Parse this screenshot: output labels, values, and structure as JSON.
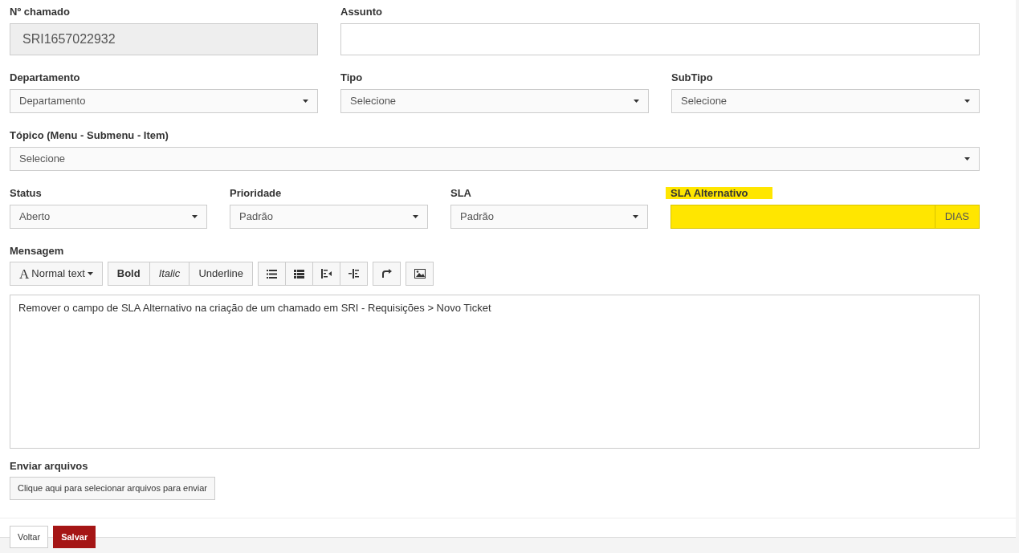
{
  "rows": [
    [
      {
        "kind": "readonly",
        "label": "Nº chamado",
        "value": "SRI1657022932"
      },
      {
        "kind": "text",
        "label": "Assunto"
      }
    ],
    [
      {
        "kind": "select",
        "label": "Departamento",
        "value": "Departamento"
      },
      {
        "kind": "select",
        "label": "Tipo",
        "value": "Selecione"
      },
      {
        "kind": "select",
        "label": "SubTipo",
        "value": "Selecione"
      }
    ],
    [
      {
        "kind": "select",
        "label": "Tópico (Menu - Submenu - Item)",
        "value": "Selecione"
      }
    ],
    [
      {
        "kind": "select",
        "label": "Status",
        "value": "Aberto"
      },
      {
        "kind": "select",
        "label": "Prioridade",
        "value": "Padrão"
      },
      {
        "kind": "select",
        "label": "SLA",
        "value": "Padrão"
      },
      {
        "kind": "addon",
        "label": "SLA Alternativo",
        "addon": "DIAS",
        "highlighted": true
      }
    ]
  ],
  "message": {
    "label": "Mensagem",
    "text": "Remover o campo de SLA Alternativo na criação de um chamado em SRI - Requisições > Novo Ticket",
    "toolbar": [
      [
        {
          "kind": "style",
          "icon": "A",
          "label": "Normal text"
        }
      ],
      [
        {
          "kind": "bold",
          "label": "Bold"
        },
        {
          "kind": "italic",
          "label": "Italic"
        },
        {
          "kind": "underline",
          "label": "Underline"
        }
      ],
      [
        {
          "kind": "bullets"
        },
        {
          "kind": "numbers"
        },
        {
          "kind": "outdent"
        },
        {
          "kind": "indent"
        }
      ],
      [
        {
          "kind": "redo"
        }
      ],
      [
        {
          "kind": "image"
        }
      ]
    ]
  },
  "upload": {
    "label": "Enviar arquivos",
    "button": "Clique aqui para selecionar arquivos para enviar"
  },
  "actions": [
    {
      "kind": "default",
      "label": "Voltar"
    },
    {
      "kind": "primary",
      "label": "Salvar"
    }
  ]
}
